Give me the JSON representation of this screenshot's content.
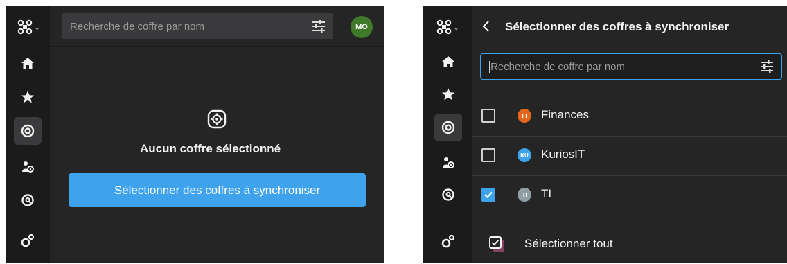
{
  "left": {
    "search": {
      "placeholder": "Recherche de coffre par nom"
    },
    "avatar": {
      "initials": "MO",
      "color": "#3f7a2a"
    },
    "empty_state": {
      "title": "Aucun coffre sélectionné"
    },
    "primary_button": {
      "label": "Sélectionner des coffres à synchroniser",
      "color": "#3ea3ec"
    }
  },
  "right": {
    "header": {
      "title": "Sélectionner des coffres à synchroniser"
    },
    "search": {
      "placeholder": "Recherche de coffre par nom"
    },
    "vaults": [
      {
        "name": "Finances",
        "initials": "FI",
        "color": "#e0661c",
        "checked": false
      },
      {
        "name": "KuriosIT",
        "initials": "KU",
        "color": "#3ea3ec",
        "checked": false
      },
      {
        "name": "TI",
        "initials": "TI",
        "color": "#8f9ea3",
        "checked": true
      }
    ],
    "select_all": {
      "label": "Sélectionner tout"
    }
  },
  "sidebar_icons": [
    "logo-icon",
    "home-icon",
    "star-icon",
    "vault-icon",
    "user-icon",
    "search-vault-icon",
    "settings-icon"
  ]
}
